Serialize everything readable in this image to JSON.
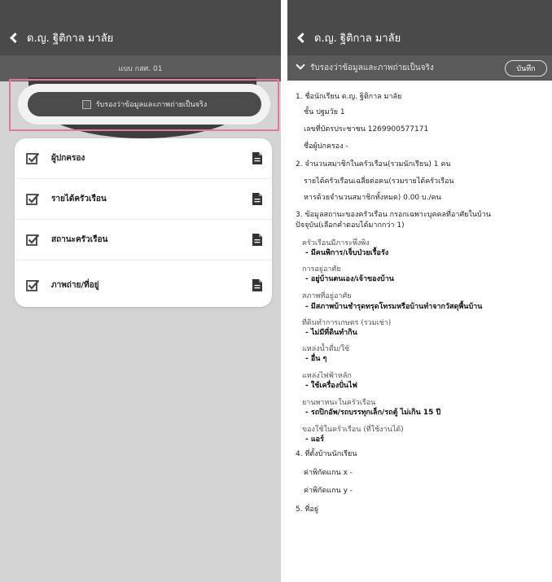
{
  "left": {
    "header": {
      "title": "ด.ญ. ฐิติกาล มาลัย"
    },
    "subheader": {
      "text": "แบบ กสศ. 01"
    },
    "certify": {
      "label": "รับรองว่าข้อมูลและภาพถ่ายเป็นจริง",
      "checked": false
    },
    "menu": [
      {
        "label": "ผู้ปกครอง",
        "checked": true,
        "icon": "document-icon"
      },
      {
        "label": "รายได้ครัวเรือน",
        "checked": true,
        "icon": "document-icon"
      },
      {
        "label": "สถานะครัวเรือน",
        "checked": true,
        "icon": "document-icon"
      },
      {
        "label": "ภาพถ่าย/ที่อยู่",
        "checked": true,
        "icon": "document-icon"
      }
    ]
  },
  "right": {
    "header": {
      "title": "ด.ญ. ฐิติกาล มาลัย"
    },
    "section": {
      "title": "รับรองว่าข้อมูลและภาพถ่ายเป็นจริง",
      "save_label": "บันทึก"
    },
    "lines": {
      "l1": "1. ชื่อนักเรียน  ด.ญ. ฐิติกาล มาลัย",
      "l2": "ชั้น  ปฐมวัย 1",
      "l3": "เลขที่บัตรประชาชน  1269900577171",
      "l4": "ชื่อผู้ปกครอง  -",
      "l5": "2. จำนวนสมาชิกในครัวเรือน(รวมนักเรียน)  1 คน",
      "l6": "รายได้ครัวเรือนเฉลี่ยต่อคน(รวมรายได้ครัวเรือน",
      "l7": "หารด้วยจำนวนสมาชิกทั้งหมด)  0.00 บ./คน",
      "l8": "3. ข้อมูลสถานะของครัวเรือน กรอกเฉพาะบุคคลที่อาศัยในบ้าน",
      "l9": "ปัจจุบัน(เลือกคำตอบได้มากกว่า 1)",
      "l10": "ครัวเรือนมีภาระพึ่งพิง",
      "l11": "- มีคนพิการ/เจ็บป่วยเรื้อรัง",
      "l12": "การอยู่อาศัย",
      "l13": "- อยู่บ้านตนเอง/เจ้าของบ้าน",
      "l14": "สภาพที่อยู่อาศัย",
      "l15": "- มีสภาพบ้านชำรุดทรุดโทรมหรือบ้านทำจากวัสดุพื้นบ้าน",
      "l16": "ที่ดินทำการเกษตร (รวมเช่า)",
      "l17": "- ไม่มีที่ดินทำกิน",
      "l18": "แหล่งน้ำดื่ม/ใช้",
      "l19": "- อื่น ๆ",
      "l20": "แหล่งไฟฟ้าหลัก",
      "l21": "- ใช้เครื่องปั่นไฟ",
      "l22": "ยานพาหนะในครัวเรือน",
      "l23": "- รถปิกอัพ/รถบรรทุกเล็ก/รถตู้ ไม่เกิน 15 ปี",
      "l24": "ของใช้ในครัวเรือน (ที่ใช้งานได้)",
      "l25": "- แอร์",
      "l26": "4. ที่ตั้งบ้านนักเรียน",
      "l27": "ค่าพิกัดแกน x  -",
      "l28": "ค่าพิกัดแกน y  -",
      "l29": "5. ที่อยู่"
    }
  },
  "colors": {
    "header": "#4a4a4a",
    "subheader": "#5a5a5a",
    "highlight": "#e5779c",
    "panel_bg": "#d4d4d4"
  }
}
